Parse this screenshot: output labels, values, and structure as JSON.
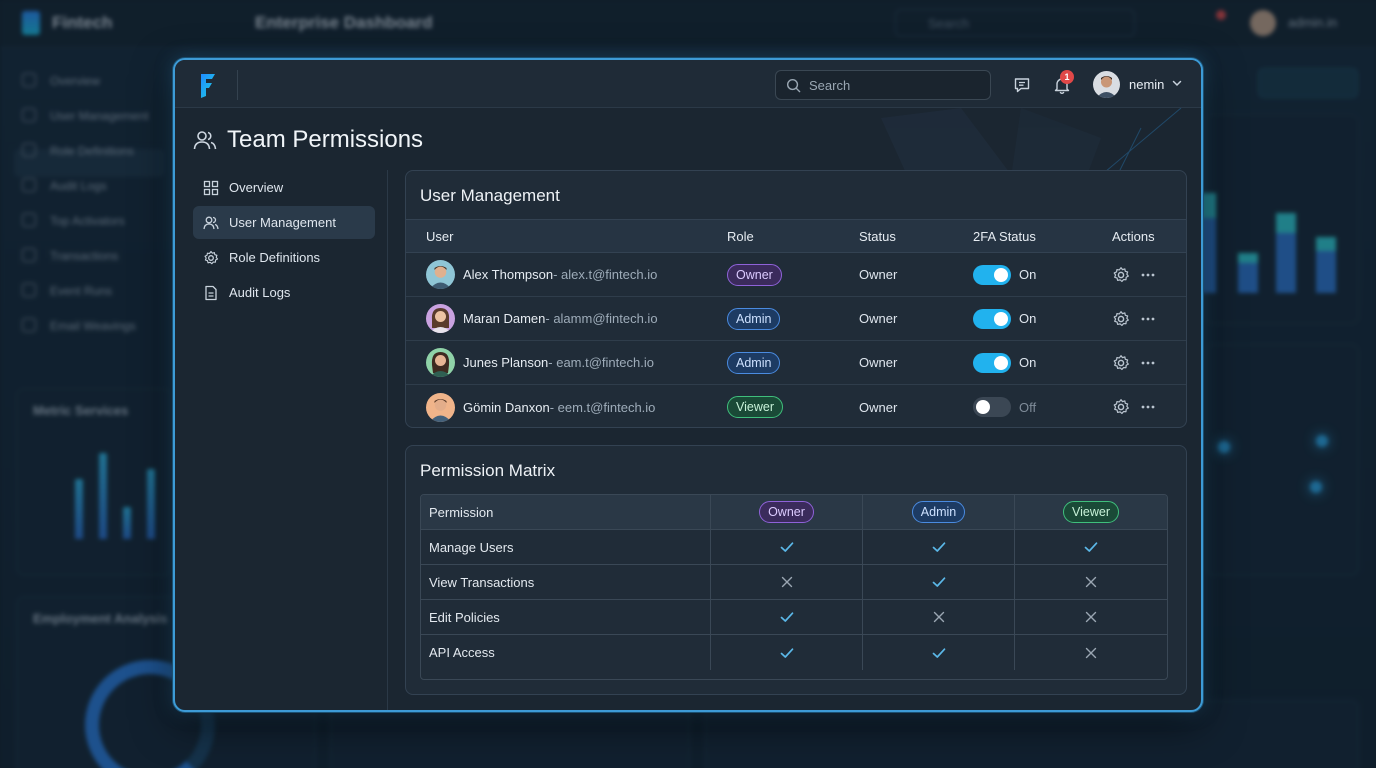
{
  "background": {
    "app_name": "Fintech",
    "title": "Enterprise Dashboard",
    "search_placeholder": "Search",
    "user_name": "admin.in",
    "nav_items": [
      "Overview",
      "User Management",
      "Role Definitions",
      "Audit Logs",
      "Top Activators",
      "Transactions",
      "Event Runs",
      "Email Weavings"
    ],
    "cards": {
      "metrics_title": "Metric Services",
      "employment_title": "Employment Analysis"
    }
  },
  "topbar": {
    "search_placeholder": "Search",
    "notification_count": "1",
    "user_name": "nemin",
    "icons": [
      "logo-icon",
      "search-icon",
      "chat-icon",
      "bell-icon",
      "chevron-down-icon"
    ]
  },
  "page": {
    "title": "Team Permissions"
  },
  "sidebar": {
    "items": [
      {
        "label": "Overview",
        "icon": "grid-icon",
        "active": false
      },
      {
        "label": "User Management",
        "icon": "users-icon",
        "active": true
      },
      {
        "label": "Role Definitions",
        "icon": "settings-cog-icon",
        "active": false
      },
      {
        "label": "Audit Logs",
        "icon": "document-icon",
        "active": false
      }
    ]
  },
  "user_management": {
    "title": "User Management",
    "columns": [
      "User",
      "Role",
      "Status",
      "2FA Status",
      "Actions"
    ],
    "rows": [
      {
        "name": "Alex Thompson",
        "email": " - alex.t@fintech.io",
        "role": "Owner",
        "status": "Owner",
        "twofa": "On",
        "twofa_on": true
      },
      {
        "name": "Maran Damen",
        "email": " - alamm@fintech.io",
        "role": "Admin",
        "status": "Owner",
        "twofa": "On",
        "twofa_on": true
      },
      {
        "name": "Junes Planson",
        "email": " - eam.t@fintech.io",
        "role": "Admin",
        "status": "Owner",
        "twofa": "On",
        "twofa_on": true
      },
      {
        "name": "Gömin Danxon",
        "email": " - eem.t@fintech.io",
        "role": "Viewer",
        "status": "Owner",
        "twofa": "Off",
        "twofa_on": false
      }
    ]
  },
  "permission_matrix": {
    "title": "Permission Matrix",
    "header": {
      "permission": "Permission",
      "roles": [
        "Owner",
        "Admin",
        "Viewer"
      ]
    },
    "rows": [
      {
        "permission": "Manage Users",
        "values": [
          true,
          true,
          true
        ]
      },
      {
        "permission": "View Transactions",
        "values": [
          false,
          true,
          false
        ]
      },
      {
        "permission": "Edit Policies",
        "values": [
          true,
          false,
          false
        ]
      },
      {
        "permission": "API Access",
        "values": [
          true,
          true,
          false
        ]
      }
    ]
  },
  "colors": {
    "accent": "#3d9bd6",
    "toggle_on": "#21b2ee",
    "check": "#5bb8e8",
    "cross": "#9aa6b2",
    "owner": "#8f62d9",
    "admin": "#4a8be0",
    "viewer": "#3fbf7c"
  }
}
